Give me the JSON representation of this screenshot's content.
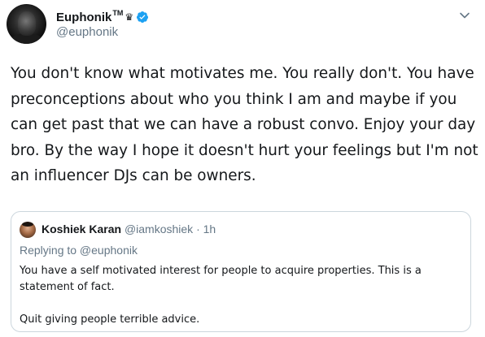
{
  "tweet": {
    "author": {
      "display_name": "Euphonik",
      "trademark": "TM",
      "crown": "♛",
      "handle": "@euphonik"
    },
    "text": "You don't know what motivates me. You really don't. You have preconceptions about who you think I am and maybe if you can get past that we can have a robust convo. Enjoy your day bro. By the way I hope it doesn't hurt your feelings but I'm not an influencer DJs can be owners."
  },
  "quoted_tweet": {
    "display_name": "Koshiek Karan",
    "handle": "@iamkoshiek",
    "separator": "·",
    "time": "1h",
    "replying_to": "Replying to @euphonik",
    "paragraphs": [
      "You have a self motivated interest for people to acquire properties. This is a statement of fact.",
      "Quit giving people terrible advice."
    ]
  },
  "colors": {
    "verified_badge": "#1da1f2",
    "secondary_text": "#657786",
    "primary_text": "#14171a",
    "border": "#ccd6dd"
  },
  "icons": {
    "verified": "verified-badge-icon",
    "more": "chevron-down-icon",
    "crown": "crown-icon"
  }
}
